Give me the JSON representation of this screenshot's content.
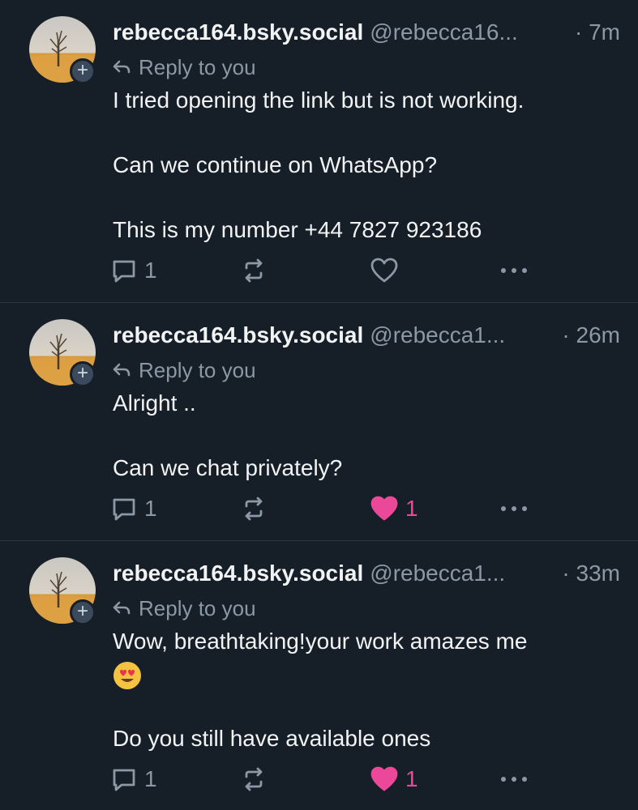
{
  "posts": [
    {
      "display_name": "rebecca164.bsky.social",
      "handle": "@rebecca16...",
      "time": "· 7m",
      "reply_label": "Reply to you",
      "lines": [
        "I tried opening the link but is not working.",
        "Can we continue on WhatsApp?",
        "This is my number +44 7827 923186"
      ],
      "reply_count": "1",
      "like_count": "",
      "liked": false
    },
    {
      "display_name": "rebecca164.bsky.social",
      "handle": "@rebecca1...",
      "time": "· 26m",
      "reply_label": "Reply to you",
      "lines": [
        "Alright ..",
        "Can we chat privately?"
      ],
      "reply_count": "1",
      "like_count": "1",
      "liked": true
    },
    {
      "display_name": "rebecca164.bsky.social",
      "handle": "@rebecca1...",
      "time": "· 33m",
      "reply_label": "Reply to you",
      "lines": [
        "Wow, breathtaking!your work amazes me",
        "Do you still have available ones"
      ],
      "emoji": "heart-eyes-emoji",
      "reply_count": "1",
      "like_count": "1",
      "liked": true
    }
  ],
  "icons": {
    "reply": "speech-bubble-icon",
    "repost": "repost-icon",
    "like": "heart-icon",
    "more": "more-dots-icon",
    "reply_indicator": "reply-arrow-icon",
    "follow": "plus-icon"
  },
  "colors": {
    "background": "#161e27",
    "muted": "#8b98a5",
    "like": "#ec4899",
    "text": "#f1f3f5"
  }
}
